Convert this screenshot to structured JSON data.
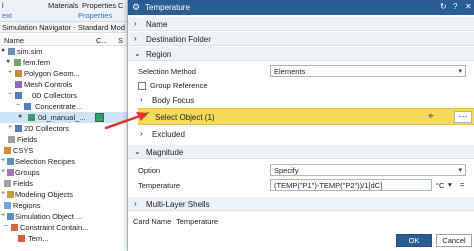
{
  "topbar": {
    "left_fragment": "l",
    "left_fragment_sub": "ext",
    "materials": "Materials",
    "properties": "Properties",
    "properties_sub": "Properties",
    "c_fragment": "C"
  },
  "navigator": {
    "title": "Simulation Navigator - Standard Mod",
    "col_name": "Name",
    "col_c": "C...",
    "col_s": "S",
    "items": [
      {
        "label": "sim.sim"
      },
      {
        "label": "fem.fem"
      },
      {
        "label": "Polygon Geom..."
      },
      {
        "label": "Mesh Controls"
      },
      {
        "label": "0D Collectors"
      },
      {
        "label": "Concentrate..."
      },
      {
        "label": "0d_manual_..."
      },
      {
        "label": "2D Collectors"
      },
      {
        "label": "Fields"
      },
      {
        "label": "CSYS"
      },
      {
        "label": "Selection Recipes"
      },
      {
        "label": "Groups"
      },
      {
        "label": "Fields"
      },
      {
        "label": "Modeling Objects"
      },
      {
        "label": "Regions"
      },
      {
        "label": "Simulation Object ..."
      },
      {
        "label": "Constraint Contain..."
      },
      {
        "label": "Tem..."
      }
    ]
  },
  "dialog": {
    "title": "Temperature",
    "sections": {
      "name": "Name",
      "destination_folder": "Destination Folder",
      "region": "Region",
      "body_focus": "Body Focus",
      "excluded": "Excluded",
      "magnitude": "Magnitude",
      "multi_layer": "Multi-Layer Shells"
    },
    "selection_method_label": "Selection Method",
    "selection_method_value": "Elements",
    "group_reference_label": "Group Reference",
    "select_object_label": "Select Object (1)",
    "option_label": "Option",
    "option_value": "Specify",
    "temperature_label": "Temperature",
    "temperature_value": "(TEMP(\"P1\")-TEMP(\"P2\"))/1[dC]",
    "temperature_unit": "°C",
    "card_name_label": "Card Name",
    "card_name_value": "Temperature",
    "ok_label": "OK",
    "cancel_label": "Cancel"
  },
  "colors": {
    "title_bar": "#2b5d95",
    "highlight": "#f4da5c",
    "arrow": "#e0332f"
  }
}
